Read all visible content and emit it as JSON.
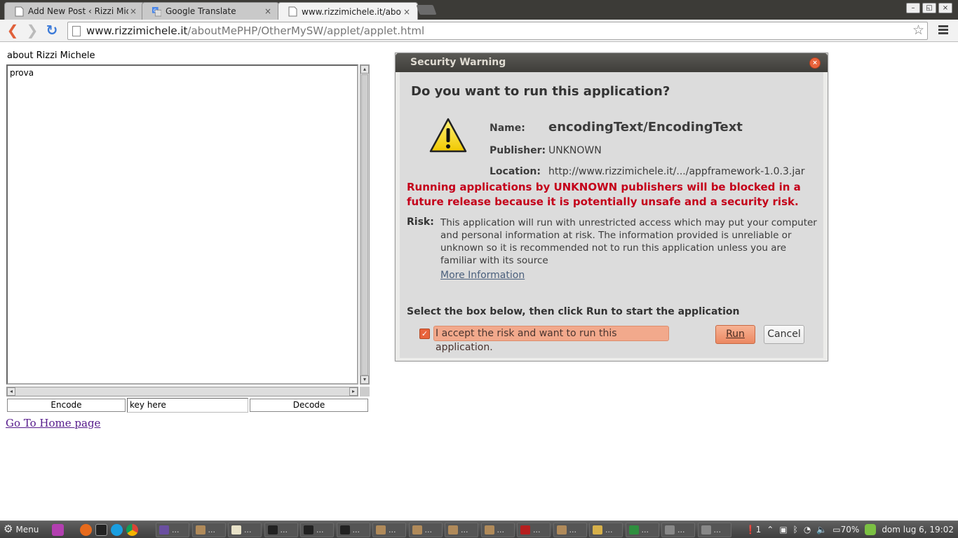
{
  "browser": {
    "tabs": [
      {
        "title": "Add New Post ‹ Rizzi Mich",
        "close": "×"
      },
      {
        "title": "Google Translate",
        "close": "×"
      },
      {
        "title": "www.rizzimichele.it/abou",
        "close": "×"
      }
    ],
    "url_host": "www.rizzimichele.it",
    "url_path": "/aboutMePHP/OtherMySW/applet/applet.html",
    "back_glyph": "❮",
    "forward_glyph": "❯",
    "reload_glyph": "↻",
    "star_glyph": "☆",
    "window_buttons": [
      "–",
      "◱",
      "×"
    ]
  },
  "page": {
    "heading": "about Rizzi Michele",
    "textarea_value": "prova",
    "encode_label": "Encode",
    "key_value": "key here",
    "decode_label": "Decode",
    "home_link": "Go To Home page"
  },
  "dialog": {
    "title": "Security Warning",
    "close_glyph": "×",
    "question": "Do you want to run this application?",
    "name_label": "Name:",
    "name_value": "encodingText/EncodingText",
    "publisher_label": "Publisher:",
    "publisher_value": "UNKNOWN",
    "location_label": "Location:",
    "location_value": "http://www.rizzimichele.it/.../appframework-1.0.3.jar",
    "red_warning": "Running applications by UNKNOWN publishers will be blocked in a future release because it is potentially unsafe and a security risk.",
    "risk_label": "Risk:",
    "risk_text": "This application will run with unrestricted access which may put your computer and personal information at risk. The information provided is unreliable or unknown so it is recommended not to run this application unless you are familiar with its source",
    "more_info": "More Information",
    "select_text": "Select the box below, then click Run to start the application",
    "accept_label": "I accept the risk and want to run this application.",
    "accept_checked": true,
    "check_glyph": "✓",
    "run_label": "Run",
    "cancel_label": "Cancel",
    "accent_color": "#e8633c",
    "warning_color": "#c4001a"
  },
  "taskbar": {
    "menu_label": "Menu",
    "gear_glyph": "⚙",
    "task_ellipsis": "...",
    "tray_notifications": "1",
    "battery": "70%",
    "clock": "dom lug  6, 19:02",
    "launchers": [
      "files-icon",
      "firefox-icon",
      "terminal-icon",
      "skype-icon",
      "chrome-icon"
    ],
    "tasks": [
      "eclipse-icon",
      "window-icon",
      "java-icon",
      "terminal-icon",
      "terminal-icon",
      "terminal-icon",
      "window-icon",
      "window-icon",
      "window-icon",
      "window-icon",
      "filezilla-icon",
      "window-icon",
      "pidgin-icon",
      "chrome-icon",
      "help-icon",
      "help-icon"
    ]
  }
}
